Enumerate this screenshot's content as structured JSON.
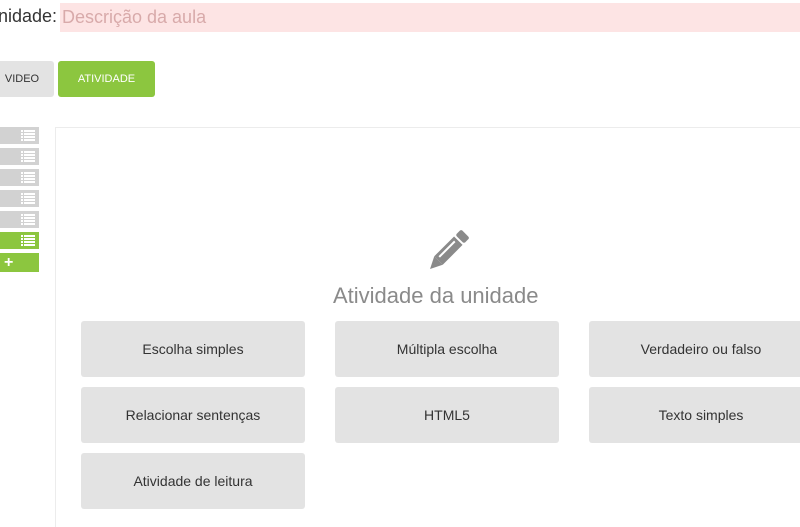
{
  "description": {
    "label": "nidade:",
    "placeholder": "Descrição da aula",
    "value": ""
  },
  "tabs": [
    {
      "label": "VIDEO",
      "active": false
    },
    {
      "label": "ATIVIDADE",
      "active": true
    }
  ],
  "sidebar": {
    "units": [
      {
        "icon": "list-icon",
        "active": false
      },
      {
        "icon": "list-icon",
        "active": false
      },
      {
        "icon": "list-icon",
        "active": false
      },
      {
        "icon": "list-icon",
        "active": false
      },
      {
        "icon": "list-icon",
        "active": false
      },
      {
        "icon": "list-icon",
        "active": true
      }
    ],
    "add_icon": "plus-icon",
    "add_symbol": "+"
  },
  "panel": {
    "icon": "pencil-icon",
    "title": "Atividade da unidade",
    "activities": [
      "Escolha simples",
      "Múltipla escolha",
      "Verdadeiro ou falso",
      "Relacionar sentenças",
      "HTML5",
      "Texto simples",
      "Atividade de leitura"
    ]
  },
  "colors": {
    "accent": "#8cc63f",
    "button_bg": "#e3e3e3",
    "input_bg": "#fde4e4",
    "inactive_unit": "#d2d2d2"
  }
}
